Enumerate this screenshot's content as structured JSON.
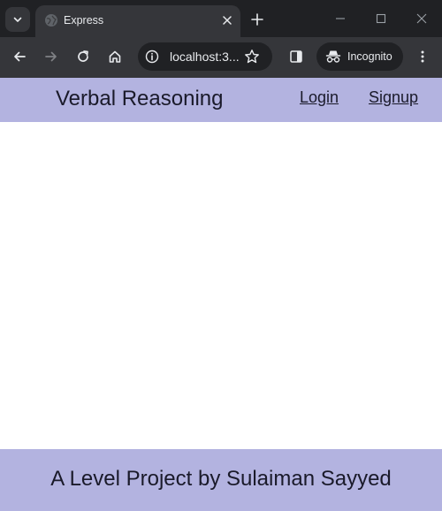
{
  "browser": {
    "tab": {
      "title": "Express",
      "favicon": "globe-icon"
    },
    "address": {
      "url": "localhost:3..."
    },
    "incognito_label": "Incognito",
    "icons": {
      "tab_search": "chevron-down-icon",
      "close_tab": "close-icon",
      "new_tab": "plus-icon",
      "back": "arrow-left-icon",
      "forward": "arrow-right-icon",
      "reload": "reload-icon",
      "home": "home-icon",
      "site_info": "info-icon",
      "bookmark": "star-icon",
      "side_panel": "side-panel-icon",
      "menu": "kebab-menu-icon"
    }
  },
  "site": {
    "title": "Verbal Reasoning",
    "nav": {
      "login": "Login",
      "signup": "Signup"
    },
    "footer": "A Level Project by Sulaiman Sayyed"
  },
  "colors": {
    "header_bg": "#b3b3e0",
    "footer_bg": "#b3b3e0",
    "chrome_dark": "#202124",
    "chrome_toolbar": "#35363a"
  }
}
